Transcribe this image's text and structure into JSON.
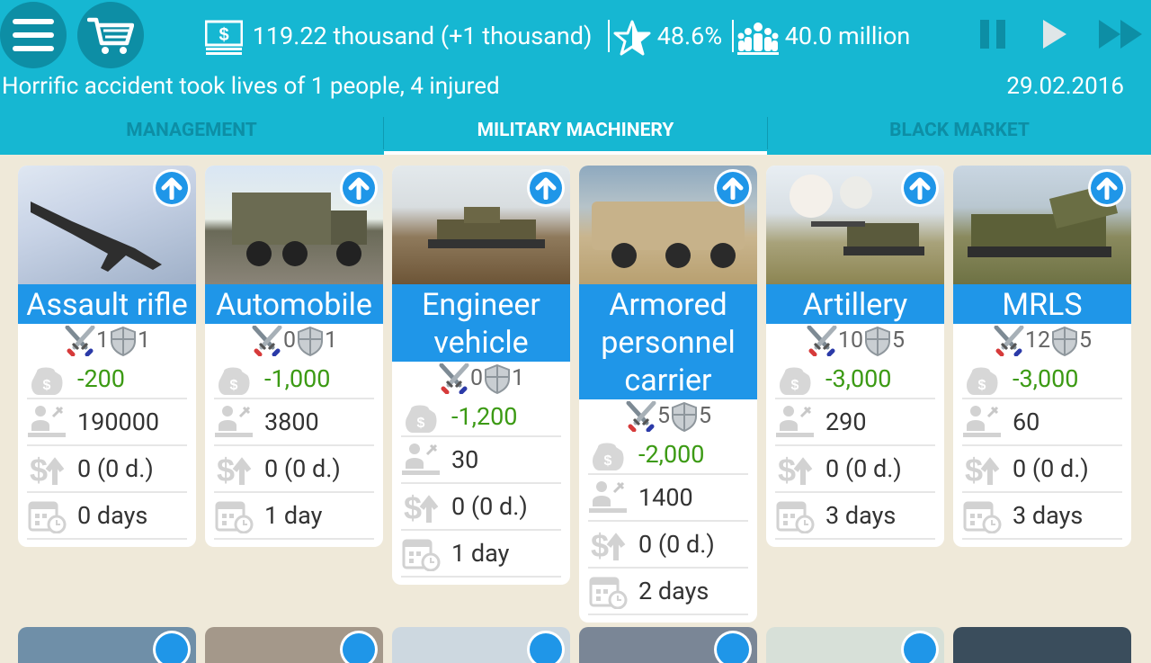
{
  "header": {
    "money": "119.22 thousand (+1 thousand)",
    "rating": "48.6%",
    "population": "40.0 million",
    "news": "Horrific accident took lives of 1 people, 4 injured",
    "date": "29.02.2016"
  },
  "tabs": [
    {
      "label": "MANAGEMENT",
      "active": false
    },
    {
      "label": "MILITARY MACHINERY",
      "active": true
    },
    {
      "label": "BLACK MARKET",
      "active": false
    }
  ],
  "cards": [
    {
      "title_lines": [
        "Assault rifle"
      ],
      "attack": "1",
      "defense": "1",
      "cost": "-200",
      "count": "190000",
      "income": "0 (0 d.)",
      "time": "0 days"
    },
    {
      "title_lines": [
        "Automobile"
      ],
      "attack": "0",
      "defense": "1",
      "cost": "-1,000",
      "count": "3800",
      "income": "0 (0 d.)",
      "time": "1 day"
    },
    {
      "title_lines": [
        "Engineer",
        "vehicle"
      ],
      "attack": "0",
      "defense": "1",
      "cost": "-1,200",
      "count": "30",
      "income": "0 (0 d.)",
      "time": "1 day"
    },
    {
      "title_lines": [
        "Armored",
        "personnel",
        "carrier"
      ],
      "attack": "5",
      "defense": "5",
      "cost": "-2,000",
      "count": "1400",
      "income": "0 (0 d.)",
      "time": "2 days"
    },
    {
      "title_lines": [
        "Artillery"
      ],
      "attack": "10",
      "defense": "5",
      "cost": "-3,000",
      "count": "290",
      "income": "0 (0 d.)",
      "time": "3 days"
    },
    {
      "title_lines": [
        "MRLS"
      ],
      "attack": "12",
      "defense": "5",
      "cost": "-3,000",
      "count": "60",
      "income": "0 (0 d.)",
      "time": "3 days"
    }
  ],
  "colors": {
    "bar": "#16b7d2",
    "title": "#1f96e8",
    "money": "#3c9a14",
    "background": "#efe9d9"
  }
}
